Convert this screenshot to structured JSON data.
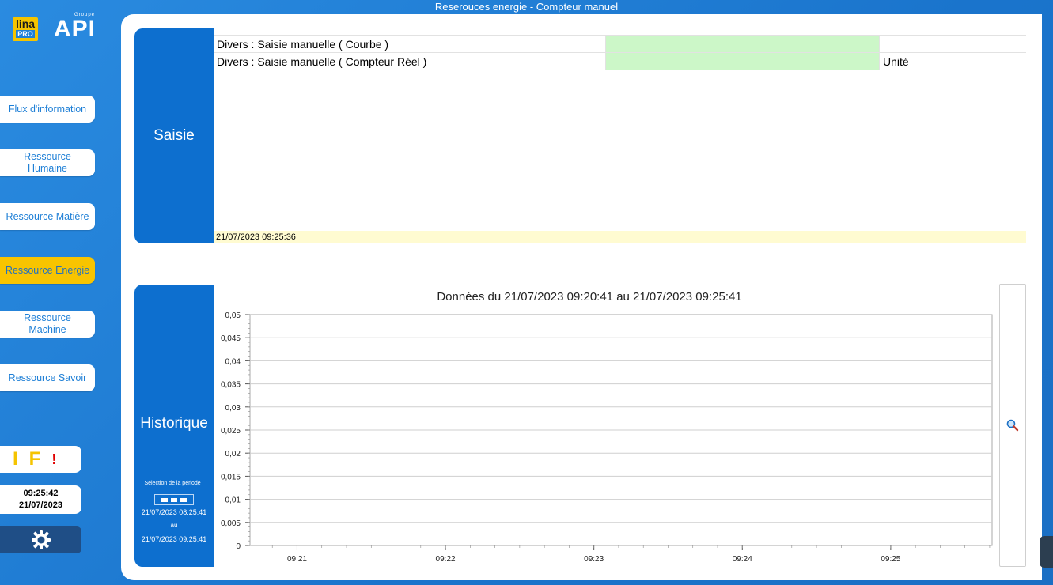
{
  "window": {
    "title": "Reserouces energie - Compteur manuel"
  },
  "logo": {
    "lina": "lina",
    "pro": "PRO",
    "api": "API",
    "groupe": "Groupe"
  },
  "nav": {
    "items": [
      {
        "label": "Flux d'information"
      },
      {
        "label": "Ressource Humaine"
      },
      {
        "label": "Ressource Matière"
      },
      {
        "label": "Ressource Energie"
      },
      {
        "label": "Ressource Machine"
      },
      {
        "label": "Ressource Savoir"
      }
    ],
    "active_index": 3,
    "active_color": "#f8c400"
  },
  "indicators": {
    "i": "I",
    "f": "F",
    "warn": "!"
  },
  "clock": {
    "time": "09:25:42",
    "date": "21/07/2023"
  },
  "saisie": {
    "title": "Saisie",
    "rows": [
      {
        "label": "Divers : Saisie manuelle ( Courbe )",
        "value": "",
        "unit": ""
      },
      {
        "label": "Divers : Saisie manuelle ( Compteur Réel )",
        "value": "",
        "unit": "Unité"
      }
    ],
    "timestamp": "21/07/2023 09:25:36",
    "input_color": "#ccf7c8"
  },
  "historique": {
    "title": "Historique",
    "selection_label": "Sélection de la période :",
    "from": "21/07/2023 08:25:41",
    "au": "au",
    "to": "21/07/2023 09:25:41"
  },
  "chart_data": {
    "type": "line",
    "title": "Données du 21/07/2023 09:20:41 au 21/07/2023 09:25:41",
    "xlabel": "",
    "ylabel": "",
    "ylim": [
      0,
      0.05
    ],
    "yticks": [
      "0",
      "0,005",
      "0,01",
      "0,015",
      "0,02",
      "0,025",
      "0,03",
      "0,035",
      "0,04",
      "0,045",
      "0,05"
    ],
    "xticks": [
      "09:21",
      "09:22",
      "09:23",
      "09:24",
      "09:25"
    ],
    "xlim_minutes": [
      20.683,
      25.683
    ],
    "series": [],
    "grid": true,
    "legend": "none"
  },
  "colors": {
    "accent": "#0d6fcf",
    "background": "#1e7fd6"
  }
}
